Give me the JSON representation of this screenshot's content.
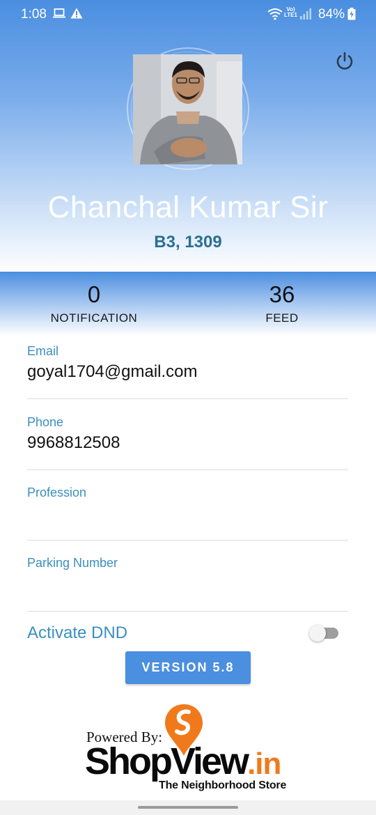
{
  "status_bar": {
    "time": "1:08",
    "battery_percent": "84%",
    "icons": [
      "laptop-icon",
      "alert-icon",
      "wifi-icon",
      "volte-icon",
      "signal-icon",
      "battery-charging-icon"
    ],
    "volte_top": "Vo)",
    "volte_bottom": "LTE1"
  },
  "header": {
    "power_icon": "power-icon",
    "name": "Chanchal Kumar Sir",
    "flat": "B3, 1309"
  },
  "stats": [
    {
      "count": "0",
      "label": "NOTIFICATION"
    },
    {
      "count": "36",
      "label": "FEED"
    }
  ],
  "fields": {
    "email": {
      "label": "Email",
      "value": "goyal1704@gmail.com"
    },
    "phone": {
      "label": "Phone",
      "value": "9968812508"
    },
    "profession": {
      "label": "Profession",
      "value": ""
    },
    "parking": {
      "label": "Parking Number",
      "value": ""
    }
  },
  "dnd": {
    "label": "Activate DND",
    "enabled": false
  },
  "version_button": "VERSION 5.8",
  "branding": {
    "powered_by": "Powered By:",
    "logo_main": "ShopView",
    "logo_tld": ".in",
    "tagline": "The Neighborhood Store"
  },
  "colors": {
    "header_blue": "#4a8ee0",
    "accent_text": "#3a8fbf",
    "flat_text": "#2a6f91",
    "button": "#4a8fe0",
    "logo_orange": "#f07a1b"
  }
}
